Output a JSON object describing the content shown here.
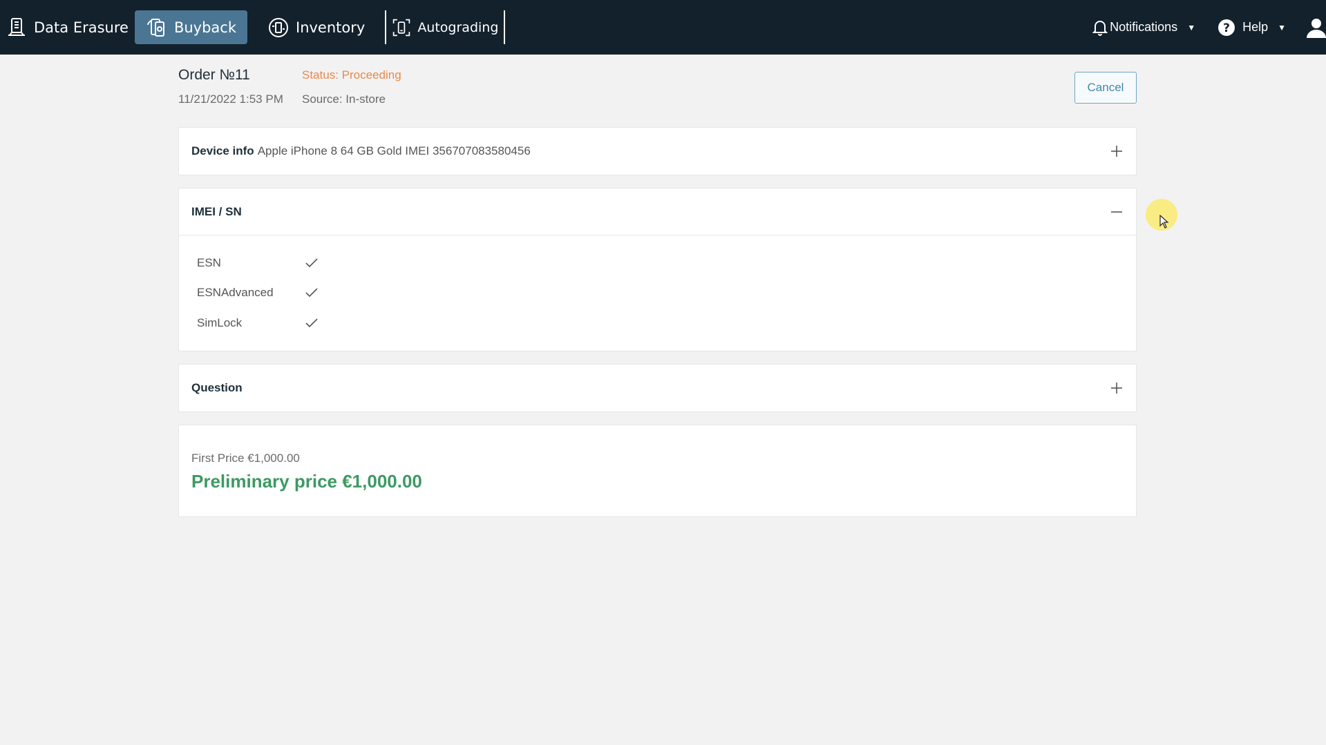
{
  "nav": {
    "items": [
      {
        "label": "Data Erasure",
        "icon": "data-erasure-icon",
        "active": false
      },
      {
        "label": "Buyback",
        "icon": "buyback-icon",
        "active": true
      },
      {
        "label": "Inventory",
        "icon": "inventory-icon",
        "active": false
      },
      {
        "label": "Autograding",
        "icon": "autograding-icon",
        "active": false
      }
    ],
    "notifications_label": "Notifications",
    "help_label": "Help",
    "user_icon": "user-icon",
    "active_color": "#4b7693",
    "bar_color": "#13212c"
  },
  "order": {
    "title": "Order №11",
    "status": "Status: Proceeding",
    "status_color": "#e8894a",
    "date": "11/21/2022 1:53 PM",
    "source": "Source: In-store",
    "cancel_label": "Cancel"
  },
  "panels": {
    "device_info": {
      "title": "Device info",
      "value": "Apple iPhone 8 64 GB Gold IMEI 356707083580456",
      "toggle_icon": "plus-icon"
    },
    "imei": {
      "title": "IMEI / SN",
      "toggle_icon": "minus-icon",
      "checks": [
        {
          "label": "ESN",
          "icon": "check-icon"
        },
        {
          "label": "ESNAdvanced",
          "icon": "check-icon"
        },
        {
          "label": "SimLock",
          "icon": "check-icon"
        }
      ]
    },
    "question": {
      "title": "Question",
      "toggle_icon": "plus-icon"
    },
    "price": {
      "first_price": "First Price €1,000.00",
      "preliminary_price": "Preliminary price €1,000.00",
      "preliminary_color": "#3c9a63"
    }
  }
}
